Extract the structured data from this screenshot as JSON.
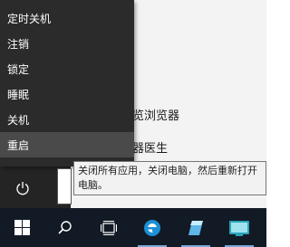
{
  "power_menu": {
    "items": [
      {
        "label": "定时关机"
      },
      {
        "label": "注销"
      },
      {
        "label": "锁定"
      },
      {
        "label": "睡眠"
      },
      {
        "label": "关机"
      },
      {
        "label": "重启"
      }
    ],
    "selected_index": 5
  },
  "start_apps": {
    "row1_suffix": "览浏览器",
    "row2_suffix": "器医生"
  },
  "tooltip": {
    "text": "关闭所有应用，关闭电脑，然后重新打开电脑。"
  },
  "taskbar": {
    "icons": [
      "windows-start-icon",
      "search-icon",
      "task-view-icon",
      "internet-explorer-icon",
      "app-icon-blue",
      "app-icon-teal"
    ]
  },
  "colors": {
    "menu_bg": "#2b2b2b",
    "menu_selected": "#4a4a4a",
    "taskbar_bg": "#121a25",
    "accent": "#1e90d6"
  }
}
